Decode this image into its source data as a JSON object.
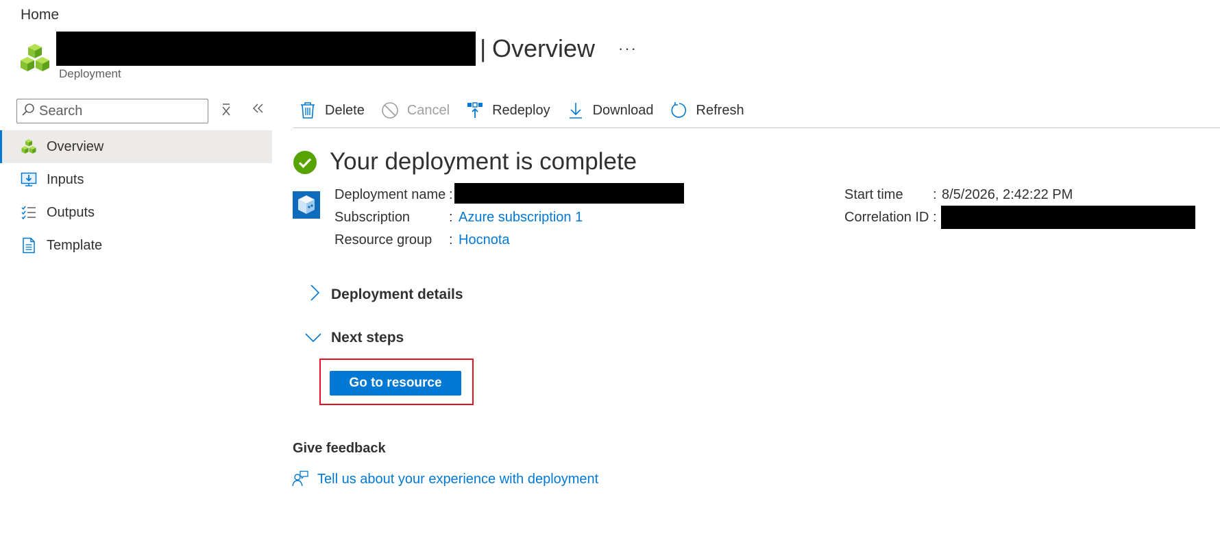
{
  "breadcrumb": {
    "home": "Home"
  },
  "header": {
    "separator": "|",
    "title": "Overview",
    "more": "···",
    "subtitle": "Deployment"
  },
  "sidebar": {
    "search_placeholder": "Search",
    "clear_icon": "clear-icon",
    "collapse_icon": "collapse-icon",
    "items": [
      {
        "label": "Overview",
        "icon": "cubes-icon",
        "active": true
      },
      {
        "label": "Inputs",
        "icon": "monitor-download-icon",
        "active": false
      },
      {
        "label": "Outputs",
        "icon": "checklist-icon",
        "active": false
      },
      {
        "label": "Template",
        "icon": "document-icon",
        "active": false
      }
    ]
  },
  "toolbar": {
    "delete": "Delete",
    "cancel": "Cancel",
    "redeploy": "Redeploy",
    "download": "Download",
    "refresh": "Refresh"
  },
  "status": {
    "title": "Your deployment is complete"
  },
  "details": {
    "deployment_name_label": "Deployment name",
    "subscription_label": "Subscription",
    "subscription_value": "Azure subscription 1",
    "resource_group_label": "Resource group",
    "resource_group_value": "Hocnota",
    "start_time_label": "Start time",
    "start_time_value": "8/5/2026, 2:42:22 PM",
    "correlation_id_label": "Correlation ID",
    "colon": ":"
  },
  "sections": {
    "deployment_details": "Deployment details",
    "next_steps": "Next steps",
    "go_to_resource": "Go to resource"
  },
  "feedback": {
    "title": "Give feedback",
    "link": "Tell us about your experience with deployment"
  },
  "colors": {
    "accent": "#0078d4",
    "success": "#57a300",
    "highlight": "#e81123"
  }
}
